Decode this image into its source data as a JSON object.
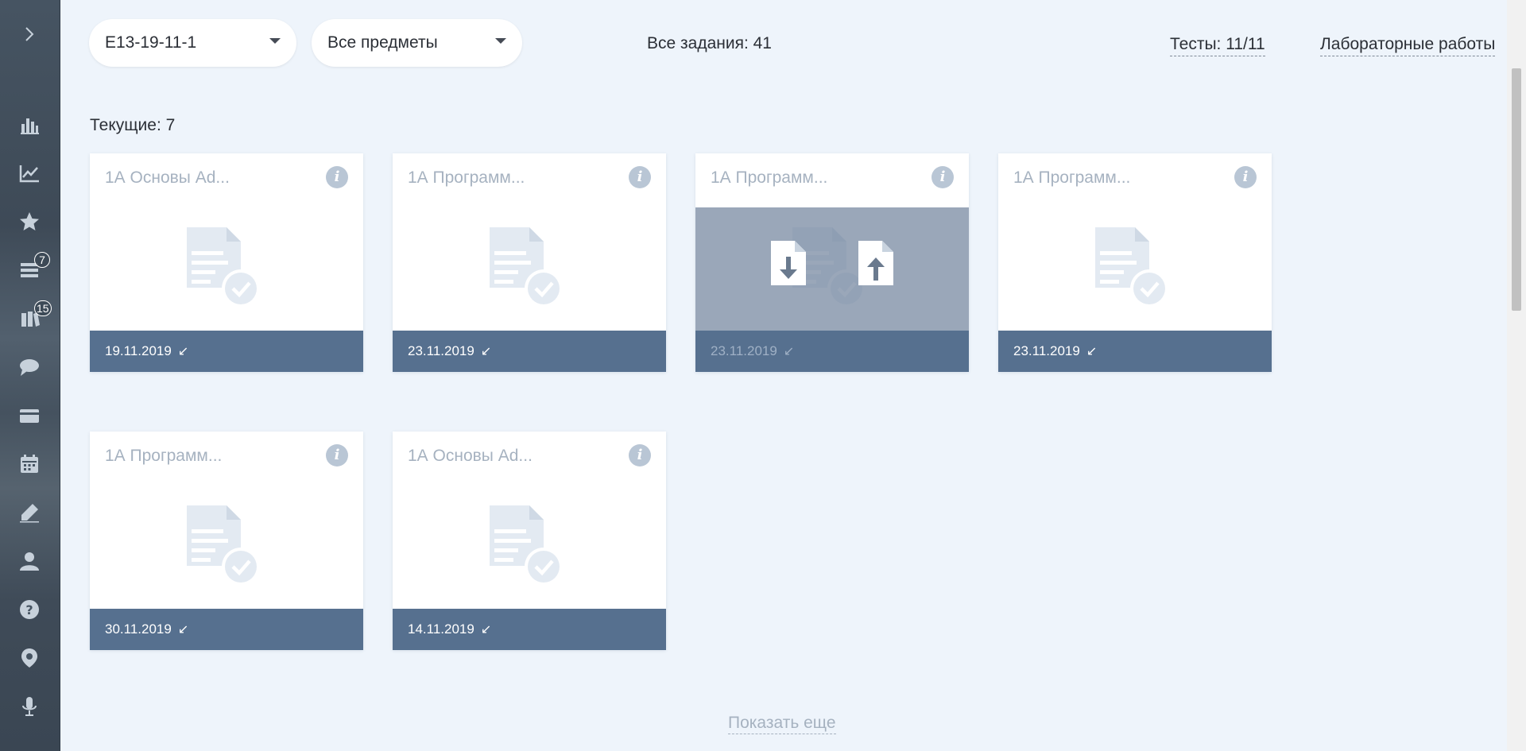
{
  "sidebar": {
    "expand_icon": "chevron-right-icon",
    "items": [
      {
        "icon": "bar-chart-icon",
        "badge": ""
      },
      {
        "icon": "line-chart-icon",
        "badge": ""
      },
      {
        "icon": "star-icon",
        "badge": ""
      },
      {
        "icon": "list-icon",
        "badge": "7"
      },
      {
        "icon": "books-icon",
        "badge": "15"
      },
      {
        "icon": "chat-icon",
        "badge": ""
      },
      {
        "icon": "card-icon",
        "badge": ""
      },
      {
        "icon": "calendar-icon",
        "badge": ""
      },
      {
        "icon": "pen-icon",
        "badge": ""
      },
      {
        "icon": "user-icon",
        "badge": ""
      },
      {
        "icon": "help-icon",
        "badge": ""
      },
      {
        "icon": "location-icon",
        "badge": ""
      },
      {
        "icon": "microphone-icon",
        "badge": ""
      }
    ]
  },
  "filters": {
    "group": "E13-19-11-1",
    "subject": "Все предметы"
  },
  "header": {
    "all_tasks": "Все задания: 41",
    "tests_link": "Тесты: 11/11",
    "labs_link": "Лабораторные работы"
  },
  "current_label": "Текущие: 7",
  "cards": [
    {
      "title": "1А Основы Ad...",
      "date": "19.11.2019"
    },
    {
      "title": "1А Программ...",
      "date": "23.11.2019"
    },
    {
      "title": "1А Программ...",
      "date": "23.11.2019"
    },
    {
      "title": "1А Программ...",
      "date": "23.11.2019"
    },
    {
      "title": "1А Программ...",
      "date": "30.11.2019"
    },
    {
      "title": "1А Основы Ad...",
      "date": "14.11.2019"
    }
  ],
  "show_more": "Показать еще",
  "colors": {
    "sidebar": "#465462",
    "card_footer": "#56708f",
    "muted_text": "#a6b2c0",
    "background": "#eef4fb"
  }
}
